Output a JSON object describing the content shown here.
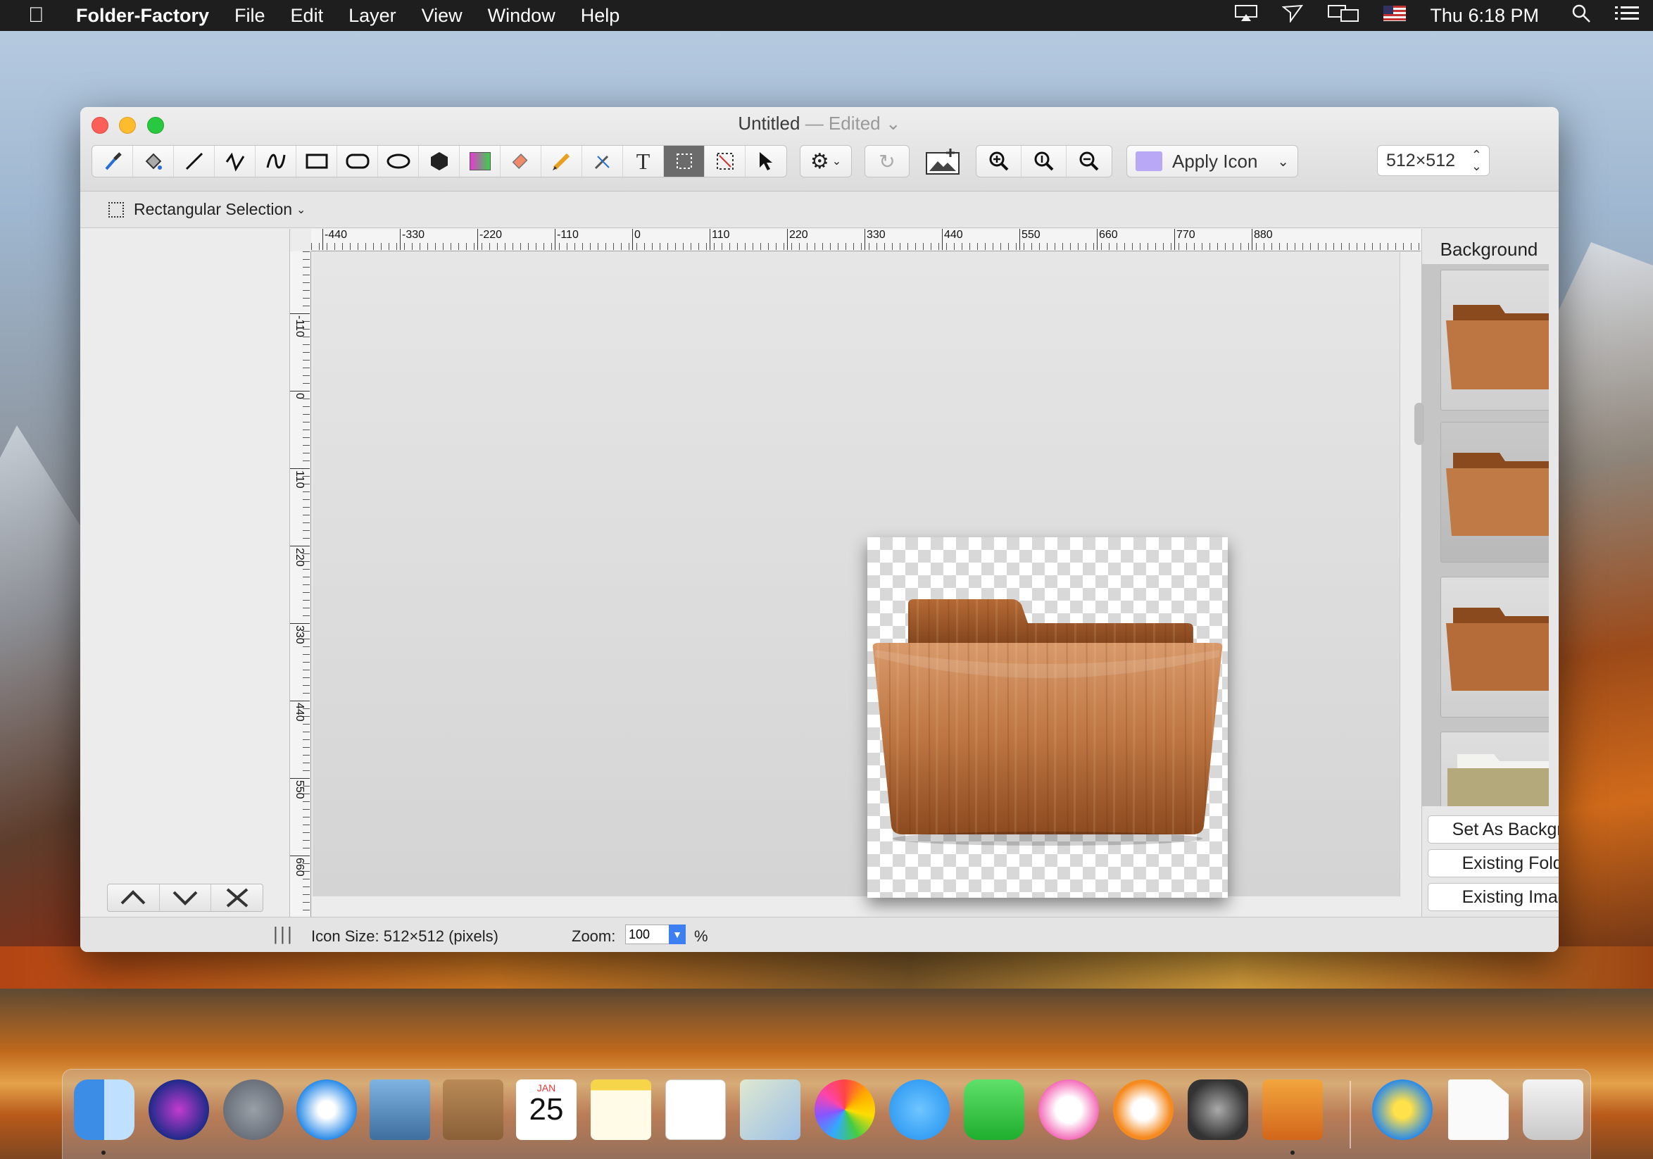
{
  "menubar": {
    "app_name": "Folder-Factory",
    "menus": [
      "File",
      "Edit",
      "Layer",
      "View",
      "Window",
      "Help"
    ],
    "clock": "Thu 6:18 PM",
    "status_icons": [
      "airplay-icon",
      "location-icon",
      "display-icon",
      "flag-icon",
      "search-icon",
      "list-icon"
    ]
  },
  "window": {
    "title": "Untitled",
    "title_sep": " — ",
    "edited": "Edited",
    "apply_label": "Apply Icon",
    "size_value": "512×512",
    "subbar_tool": "Rectangular Selection"
  },
  "toolbar": {
    "tools": [
      "eyedropper-icon",
      "paint-bucket-icon",
      "line-icon",
      "polyline-icon",
      "curve-icon",
      "rectangle-icon",
      "rounded-rectangle-icon",
      "ellipse-icon",
      "polygon-icon",
      "gradient-icon",
      "eraser-icon",
      "pencil-icon",
      "magic-wand-icon",
      "text-icon",
      "rectangular-selection-icon",
      "lasso-selection-icon",
      "pointer-icon"
    ],
    "active_tool": "rectangular-selection-icon"
  },
  "rulers": {
    "horizontal": [
      "-440",
      "-330",
      "-220",
      "-110",
      "0",
      "110",
      "220",
      "330",
      "440",
      "550",
      "660",
      "770",
      "880"
    ],
    "vertical": [
      "-110",
      "0",
      "110",
      "220",
      "330",
      "440",
      "550",
      "660"
    ]
  },
  "background_panel": {
    "title": "Background",
    "buttons": [
      "Set As Background",
      "Existing Folder...",
      "Existing Image..."
    ]
  },
  "status": {
    "icon_size": "Icon Size: 512×512 (pixels)",
    "zoom_label": "Zoom:",
    "zoom_value": "100",
    "zoom_unit": "%"
  },
  "colors": {
    "wood_light": "#c98a52",
    "wood_dark": "#8a4a1e",
    "accent": "#3b7ff0"
  },
  "dock": [
    "finder-icon",
    "siri-icon",
    "launchpad-icon",
    "safari-icon",
    "mail-icon",
    "contacts-icon",
    "calendar-icon",
    "notes-icon",
    "reminders-icon",
    "maps-icon",
    "photos-icon",
    "messages-icon",
    "facetime-icon",
    "itunes-icon",
    "ibooks-icon",
    "system-preferences-icon",
    "folder-factory-icon",
    "utility-icon",
    "document-icon",
    "trash-icon"
  ],
  "calendar": {
    "month": "JAN",
    "day": "25"
  }
}
